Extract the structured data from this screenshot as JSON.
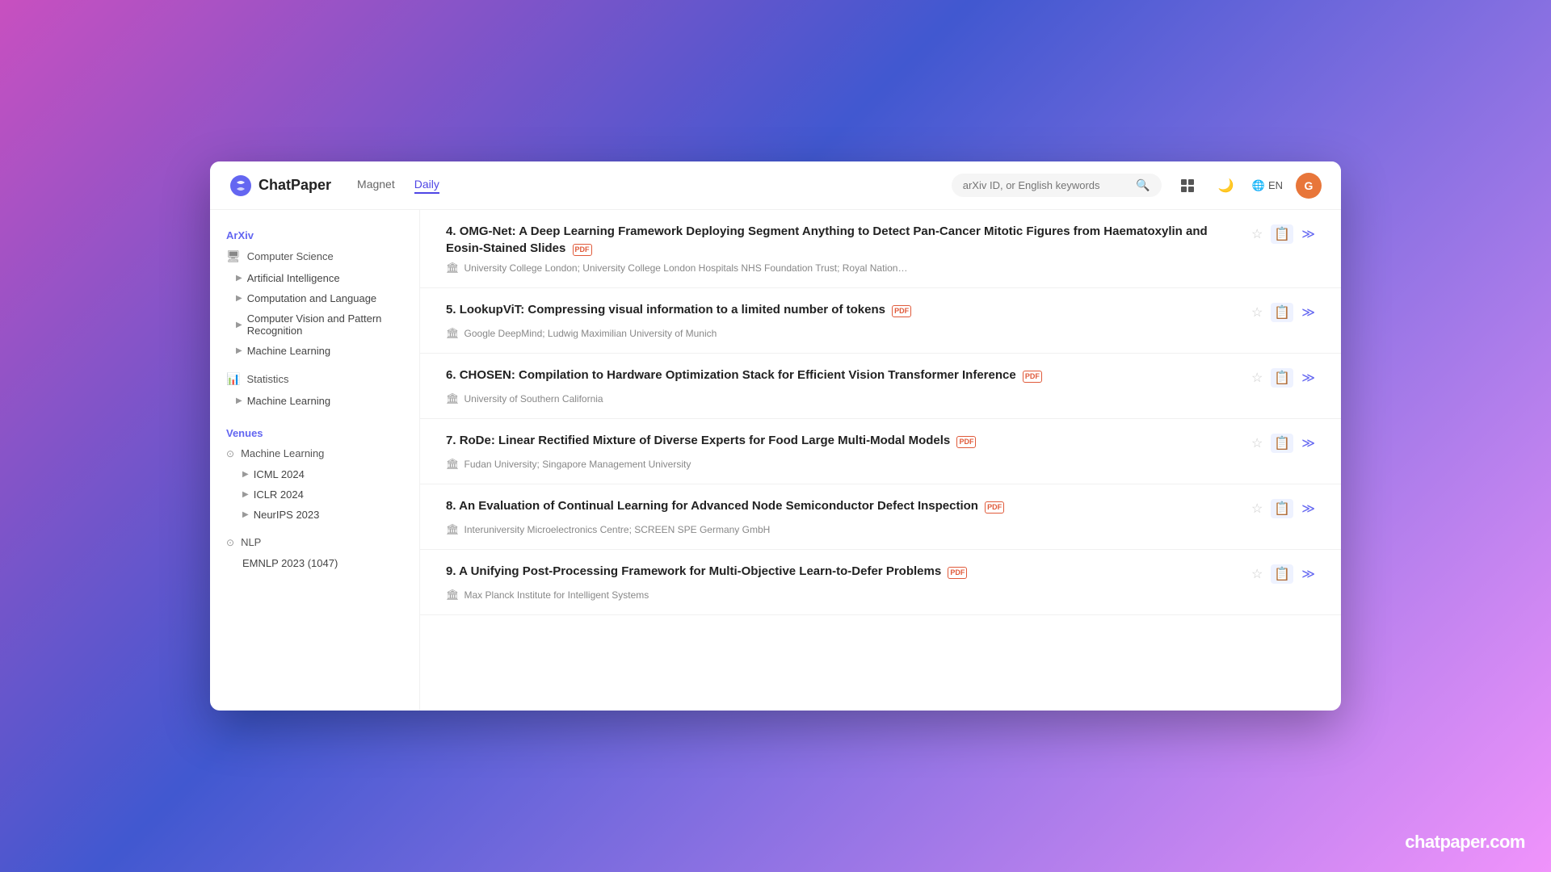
{
  "app": {
    "name": "ChatPaper",
    "nav": {
      "magnet_label": "Magnet",
      "daily_label": "Daily",
      "active": "Daily"
    },
    "search": {
      "placeholder": "arXiv ID, or English keywords"
    },
    "header_actions": {
      "lang": "EN",
      "avatar_letter": "G"
    }
  },
  "sidebar": {
    "sections": [
      {
        "id": "arxiv",
        "title": "ArXiv",
        "categories": [
          {
            "id": "computer-science",
            "label": "Computer Science",
            "icon": "🖥",
            "items": [
              {
                "id": "ai",
                "label": "Artificial Intelligence"
              },
              {
                "id": "cl",
                "label": "Computation and Language"
              },
              {
                "id": "cv",
                "label": "Computer Vision and Pattern Recognition"
              },
              {
                "id": "ml",
                "label": "Machine Learning"
              }
            ]
          },
          {
            "id": "statistics",
            "label": "Statistics",
            "icon": "📊",
            "items": [
              {
                "id": "stat-ml",
                "label": "Machine Learning"
              }
            ]
          }
        ]
      },
      {
        "id": "venues",
        "title": "Venues",
        "categories": [
          {
            "id": "venues-ml",
            "label": "Machine Learning",
            "icon": "⭕",
            "items": [
              {
                "id": "icml",
                "label": "ICML 2024"
              },
              {
                "id": "iclr",
                "label": "ICLR 2024"
              },
              {
                "id": "neurips",
                "label": "NeurIPS 2023"
              }
            ]
          },
          {
            "id": "venues-nlp",
            "label": "NLP",
            "icon": "⭕",
            "items": [
              {
                "id": "emnlp",
                "label": "EMNLP 2023 (1047)"
              }
            ]
          }
        ]
      }
    ]
  },
  "papers": [
    {
      "id": 4,
      "number": "4.",
      "title": "OMG-Net: A Deep Learning Framework Deploying Segment Anything to Detect Pan-Cancer Mitotic Figures from Haematoxylin and Eosin-Stained Slides",
      "has_pdf": true,
      "authors": "University College London; University College London Hospitals NHS Foundation Trust; Royal Nation…",
      "starred": false
    },
    {
      "id": 5,
      "number": "5.",
      "title": "LookupViT: Compressing visual information to a limited number of tokens",
      "has_pdf": true,
      "authors": "Google DeepMind; Ludwig Maximilian University of Munich",
      "starred": false
    },
    {
      "id": 6,
      "number": "6.",
      "title": "CHOSEN: Compilation to Hardware Optimization Stack for Efficient Vision Transformer Inference",
      "has_pdf": true,
      "authors": "University of Southern California",
      "starred": false
    },
    {
      "id": 7,
      "number": "7.",
      "title": "RoDe: Linear Rectified Mixture of Diverse Experts for Food Large Multi-Modal Models",
      "has_pdf": true,
      "authors": "Fudan University; Singapore Management University",
      "starred": false
    },
    {
      "id": 8,
      "number": "8.",
      "title": "An Evaluation of Continual Learning for Advanced Node Semiconductor Defect Inspection",
      "has_pdf": true,
      "authors": "Interuniversity Microelectronics Centre; SCREEN SPE Germany GmbH",
      "starred": false
    },
    {
      "id": 9,
      "number": "9.",
      "title": "A Unifying Post-Processing Framework for Multi-Objective Learn-to-Defer Problems",
      "has_pdf": true,
      "authors": "Max Planck Institute for Intelligent Systems",
      "starred": false
    }
  ],
  "branding": "chatpaper.com"
}
